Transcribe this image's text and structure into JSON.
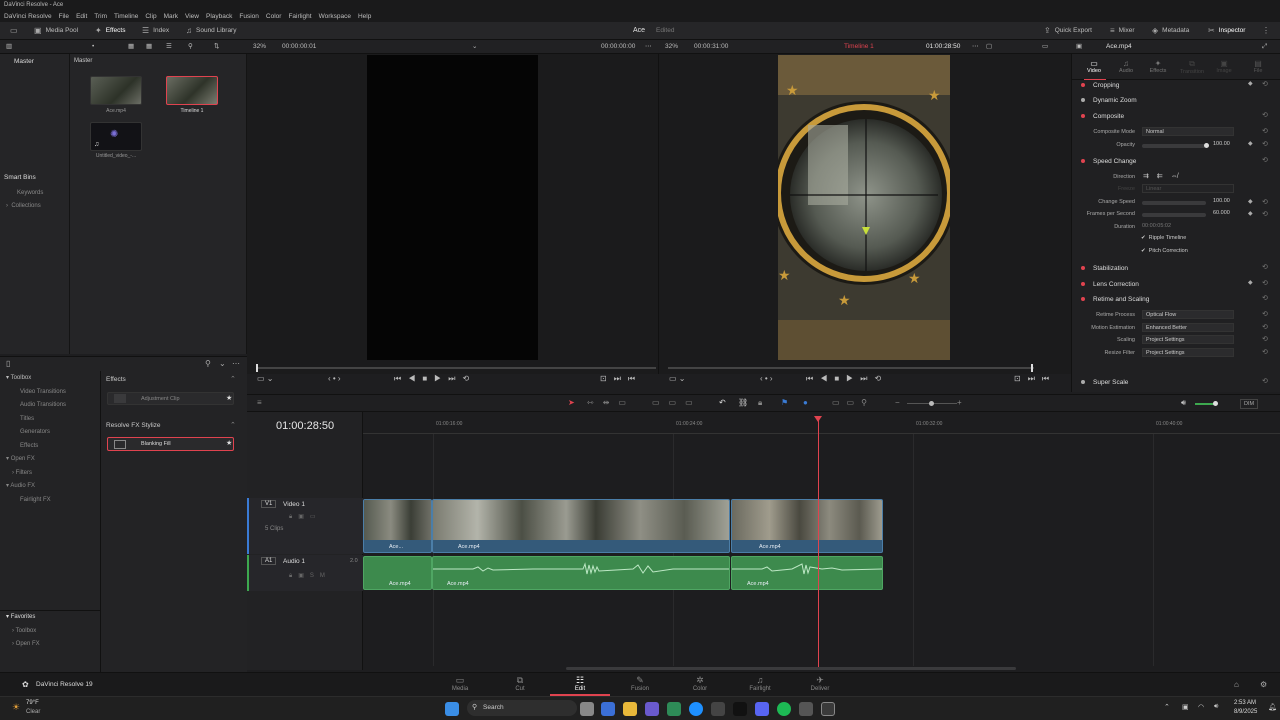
{
  "window": {
    "title": "DaVinci Resolve - Ace"
  },
  "menu": [
    "DaVinci Resolve",
    "File",
    "Edit",
    "Trim",
    "Timeline",
    "Clip",
    "Mark",
    "View",
    "Playback",
    "Fusion",
    "Color",
    "Fairlight",
    "Workspace",
    "Help"
  ],
  "toolbar": {
    "media_pool": "Media Pool",
    "effects": "Effects",
    "index": "Index",
    "sound_library": "Sound Library",
    "project_title": "Ace",
    "project_status": "Edited",
    "quick_export": "Quick Export",
    "mixer": "Mixer",
    "metadata": "Metadata",
    "inspector": "Inspector"
  },
  "subtoolbar": {
    "src_zoom": "32%",
    "src_tc_left": "00:00:00:01",
    "src_tc_right": "00:00:00:00",
    "tl_zoom": "32%",
    "tl_duration": "00:00:31:00",
    "timeline_name": "Timeline 1",
    "tl_tc": "01:00:28:50",
    "clip_name": "Ace.mp4"
  },
  "bins": {
    "master": "Master",
    "smart_bins": "Smart Bins",
    "keywords": "Keywords",
    "collections": "Collections"
  },
  "media_pool": {
    "header": "Master",
    "items": [
      {
        "label": "Ace.mp4"
      },
      {
        "label": "Timeline 1"
      },
      {
        "label": "Untitled_video_-..."
      }
    ]
  },
  "effects_library": {
    "tree": [
      "Toolbox",
      "Video Transitions",
      "Audio Transitions",
      "Titles",
      "Generators",
      "Effects",
      "Open FX",
      "Filters",
      "Audio FX",
      "Fairlight FX"
    ],
    "favorites_header": "Favorites",
    "favorites": [
      "Toolbox",
      "Open FX"
    ],
    "group1": "Effects",
    "item1": "Adjustment Clip",
    "group2": "Resolve FX Stylize",
    "item2": "Blanking Fill"
  },
  "inspector": {
    "tabs": [
      "Video",
      "Audio",
      "Effects",
      "Transition",
      "Image",
      "File"
    ],
    "sections": {
      "cropping": "Cropping",
      "dynamic_zoom": "Dynamic Zoom",
      "composite": "Composite",
      "speed_change": "Speed Change",
      "stabilization": "Stabilization",
      "lens_correction": "Lens Correction",
      "retime": "Retime and Scaling",
      "super_scale": "Super Scale"
    },
    "props": {
      "composite_mode_label": "Composite Mode",
      "composite_mode": "Normal",
      "opacity_label": "Opacity",
      "opacity": "100.00",
      "direction_label": "Direction",
      "freeze_label": "Freeze",
      "freeze": "Linear",
      "change_speed_label": "Change Speed",
      "change_speed": "100.00",
      "fps_label": "Frames per Second",
      "fps": "60.000",
      "duration_label": "Duration",
      "duration": "00:00:05:02",
      "ripple": "Ripple Timeline",
      "pitch": "Pitch Correction",
      "retime_process_label": "Retime Process",
      "retime_process": "Optical Flow",
      "motion_est_label": "Motion Estimation",
      "motion_est": "Enhanced Better",
      "scaling_label": "Scaling",
      "scaling": "Project Settings",
      "resize_filter_label": "Resize Filter",
      "resize_filter": "Project Settings"
    }
  },
  "timeline": {
    "timecode": "01:00:28:50",
    "ruler": [
      "01:00:16:00",
      "01:00:24:00",
      "01:00:32:00",
      "01:00:40:00"
    ],
    "v1_tag": "V1",
    "v1_name": "Video 1",
    "v1_count": "5 Clips",
    "a1_tag": "A1",
    "a1_name": "Audio 1",
    "a1_ch": "2.0",
    "video_clips": [
      "Ace...",
      "Ace.mp4",
      "Ace.mp4"
    ],
    "audio_clips": [
      "Ace.mp4",
      "Ace.mp4",
      "Ace.mp4"
    ],
    "dim": "DIM"
  },
  "pages": {
    "app_name": "DaVinci Resolve 19",
    "tabs": [
      "Media",
      "Cut",
      "Edit",
      "Fusion",
      "Color",
      "Fairlight",
      "Deliver"
    ],
    "active": "Edit"
  },
  "taskbar": {
    "weather_temp": "79°F",
    "weather_desc": "Clear",
    "search": "Search",
    "time": "2:53 AM",
    "date": "8/9/2025"
  },
  "colors": {
    "accent": "#e0434f",
    "video_clip": "#345a7a",
    "audio_clip": "#3d8a4d"
  }
}
